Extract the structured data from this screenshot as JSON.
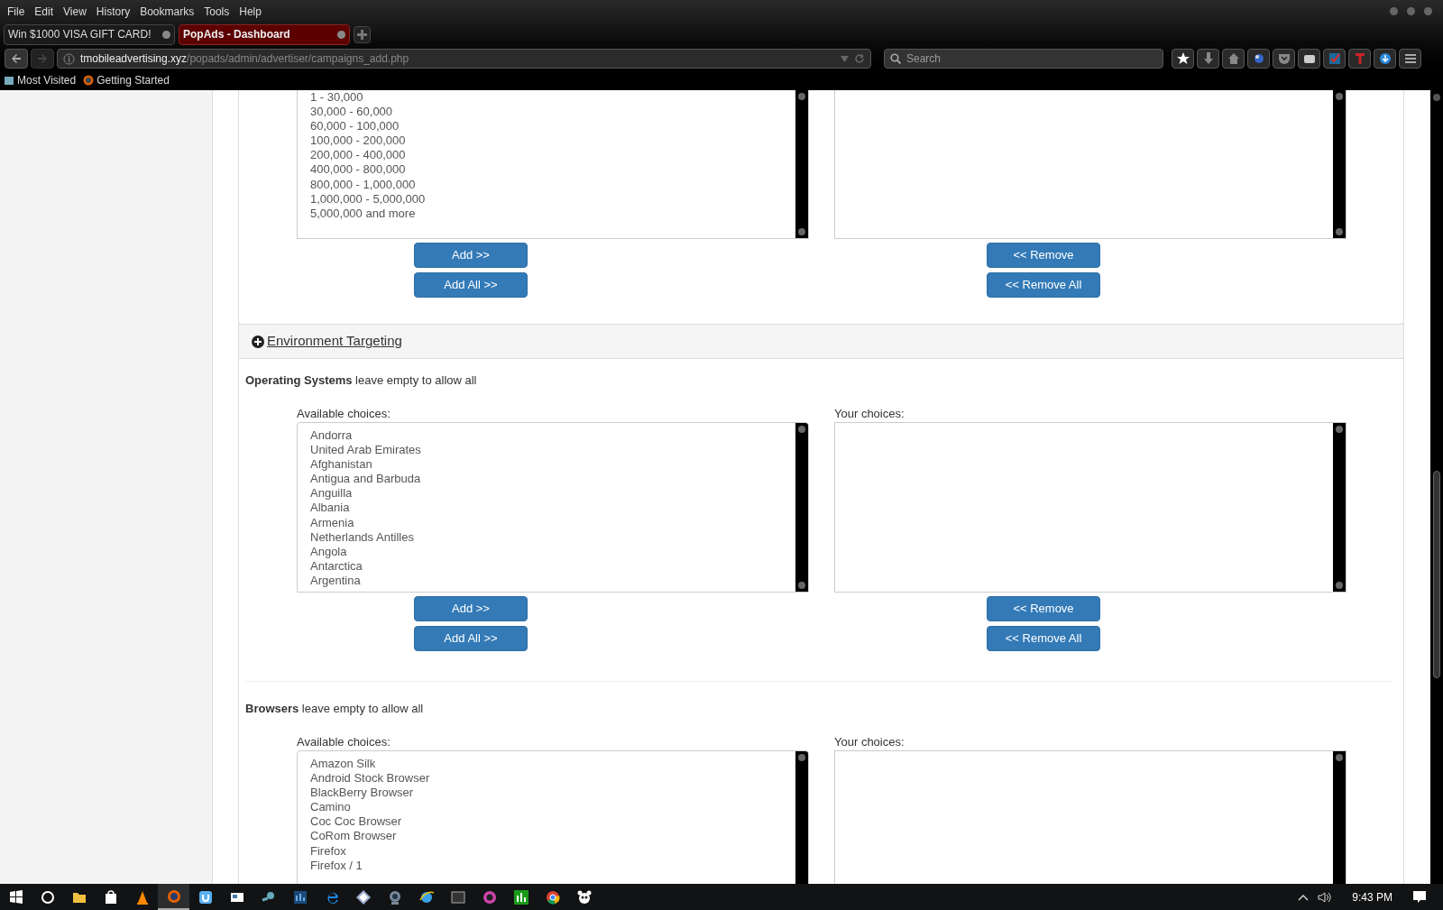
{
  "browser": {
    "menu": [
      "File",
      "Edit",
      "View",
      "History",
      "Bookmarks",
      "Tools",
      "Help"
    ],
    "tabs": [
      {
        "label": "Win $1000 VISA GIFT CARD!",
        "selected": false
      },
      {
        "label": "PopAds - Dashboard",
        "selected": true
      }
    ],
    "address": {
      "domain": "tmobileadvertising.xyz",
      "path": "/popads/admin/advertiser/campaigns_add.php"
    },
    "search": {
      "placeholder": "Search"
    },
    "bookmarks": [
      "Most Visited",
      "Getting Started"
    ]
  },
  "page": {
    "partial_chooser": {
      "available": [
        "1 - 30,000",
        "30,000 - 60,000",
        "60,000 - 100,000",
        "100,000 - 200,000",
        "200,000 - 400,000",
        "400,000 - 800,000",
        "800,000 - 1,000,000",
        "1,000,000 - 5,000,000",
        "5,000,000 and more"
      ],
      "buttons": {
        "add": "Add >>",
        "add_all": "Add All >>",
        "remove": "<< Remove",
        "remove_all": "<< Remove All"
      }
    },
    "section": {
      "title": "Environment Targeting"
    },
    "fields": [
      {
        "name": "Operating Systems",
        "hint": "leave empty to allow all",
        "available_label": "Available choices:",
        "chosen_label": "Your choices:",
        "available": [
          "Andorra",
          "United Arab Emirates",
          "Afghanistan",
          "Antigua and Barbuda",
          "Anguilla",
          "Albania",
          "Armenia",
          "Netherlands Antilles",
          "Angola",
          "Antarctica",
          "Argentina"
        ],
        "buttons": {
          "add": "Add >>",
          "add_all": "Add All >>",
          "remove": "<< Remove",
          "remove_all": "<< Remove All"
        }
      },
      {
        "name": "Browsers",
        "hint": "leave empty to allow all",
        "available_label": "Available choices:",
        "chosen_label": "Your choices:",
        "available": [
          "Amazon Silk",
          "Android Stock Browser",
          "BlackBerry Browser",
          "Camino",
          "Coc Coc Browser",
          "CoRom Browser",
          "Firefox",
          "Firefox / 1"
        ]
      }
    ]
  },
  "taskbar": {
    "clock": "9:43 PM"
  }
}
